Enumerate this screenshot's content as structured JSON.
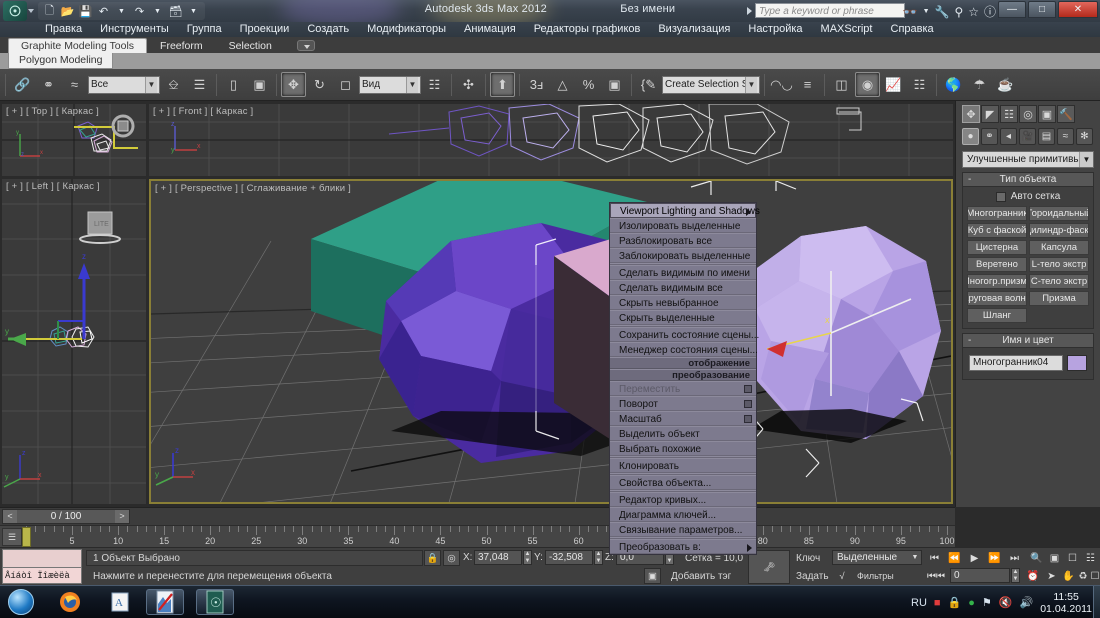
{
  "titlebar": {
    "app_title": "Autodesk 3ds Max  2012",
    "doc_title": "Без имени",
    "search_placeholder": "Type a keyword or phrase",
    "quick_access": [
      "new-icon",
      "open-icon",
      "save-icon",
      "undo-icon",
      "redo-icon",
      "set-icon"
    ],
    "window_buttons": {
      "minimize": "—",
      "maximize": "□",
      "close": "✕"
    },
    "help_icons": [
      "binoculars-icon",
      "wrench-icon",
      "subscription-icon",
      "favorites-icon",
      "help-icon"
    ]
  },
  "menu": {
    "items": [
      "Правка",
      "Инструменты",
      "Группа",
      "Проекции",
      "Создать",
      "Модификаторы",
      "Анимация",
      "Редакторы графиков",
      "Визуализация",
      "Настройка",
      "MAXScript",
      "Справка"
    ]
  },
  "ribbon": {
    "tabs": [
      "Graphite Modeling Tools",
      "Freeform",
      "Selection"
    ],
    "active_tab": "Graphite Modeling Tools",
    "sub_tab": "Polygon Modeling"
  },
  "toolbar": {
    "selection_filter": "Все",
    "reference_coord": "Вид",
    "named_selection_sets": "Create Selection Se",
    "icons_left": [
      "link-icon",
      "unlink-icon",
      "bind-space-warp-icon"
    ],
    "icons_mid": [
      "select-object-icon",
      "select-by-name-icon",
      "rect-selection-icon",
      "window-crossing-icon",
      "select-move-icon",
      "select-rotate-icon",
      "select-scale-icon"
    ],
    "icons_right": [
      "use-pivot-icon",
      "use-selection-center-icon",
      "snap-toggle-icon",
      "angle-snap-icon",
      "percent-snap-icon",
      "spinner-snap-icon",
      "edit-named-sets-icon",
      "mirror-icon",
      "align-icon",
      "layer-manager-icon",
      "curve-editor-icon",
      "schematic-view-icon",
      "material-editor-icon",
      "render-setup-icon",
      "render-frame-icon",
      "render-production-icon"
    ]
  },
  "viewports": [
    {
      "name": "viewport-top",
      "label": "[ + ] [ Top ] [ Каркас ]"
    },
    {
      "name": "viewport-front",
      "label": "[ + ] [ Front ] [ Каркас ]"
    },
    {
      "name": "viewport-left",
      "label": "[ + ] [ Left ] [ Каркас ]"
    },
    {
      "name": "viewport-persp",
      "label": "[ + ] [ Perspective ] [ Сглаживание + блики ]"
    }
  ],
  "context_menu": {
    "items": [
      {
        "label": "Viewport Lighting and Shadows",
        "submenu": true,
        "highlight": true,
        "dim": false
      },
      {
        "label": "Изолировать выделенные",
        "submenu": false,
        "highlight": false,
        "dim": false
      },
      {
        "label": "Разблокировать все",
        "submenu": false,
        "highlight": false,
        "dim": false
      },
      {
        "label": "Заблокировать выделенные",
        "submenu": false,
        "highlight": false,
        "dim": false
      },
      {
        "label": "Сделать видимым по имени",
        "submenu": false,
        "highlight": false,
        "dim": false
      },
      {
        "label": "Сделать видимым все",
        "submenu": false,
        "highlight": false,
        "dim": false
      },
      {
        "label": "Скрыть невыбранное",
        "submenu": false,
        "highlight": false,
        "dim": false
      },
      {
        "label": "Скрыть выделенные",
        "submenu": false,
        "highlight": false,
        "dim": false
      },
      {
        "label": "Сохранить состояние сцены...",
        "submenu": false,
        "highlight": false,
        "dim": false
      },
      {
        "label": "Менеджер состояния сцены...",
        "submenu": false,
        "highlight": false,
        "dim": false
      }
    ],
    "header_display": "отображение",
    "header_transform": "преобразование",
    "transform_items": [
      {
        "label": "Переместить",
        "check": true,
        "dim": true,
        "submenu": false
      },
      {
        "label": "Поворот",
        "check": true,
        "dim": false,
        "submenu": false
      },
      {
        "label": "Масштаб",
        "check": true,
        "dim": false,
        "submenu": false
      },
      {
        "label": "Выделить объект",
        "check": false,
        "dim": false,
        "submenu": false
      },
      {
        "label": "Выбрать похожие",
        "check": false,
        "dim": false,
        "submenu": false
      },
      {
        "label": "Клонировать",
        "check": false,
        "dim": false,
        "submenu": false
      },
      {
        "label": "Свойства объекта...",
        "check": false,
        "dim": false,
        "submenu": false
      },
      {
        "label": "Редактор кривых...",
        "check": false,
        "dim": false,
        "submenu": false
      },
      {
        "label": "Диаграмма ключей...",
        "check": false,
        "dim": false,
        "submenu": false
      },
      {
        "label": "Связывание параметров...",
        "check": false,
        "dim": false,
        "submenu": false
      },
      {
        "label": "Преобразовать в:",
        "check": false,
        "dim": false,
        "submenu": true
      }
    ]
  },
  "command_panel": {
    "tabs": [
      "create-icon",
      "modify-icon",
      "hierarchy-icon",
      "motion-icon",
      "display-icon",
      "utilities-icon"
    ],
    "active_tab_index": 0,
    "categories": [
      "geometry-icon",
      "shapes-icon",
      "lights-icon",
      "cameras-icon",
      "helpers-icon",
      "space-warps-icon",
      "systems-icon"
    ],
    "active_category_index": 0,
    "category_dropdown": "Улучшенные примитивы",
    "object_type": {
      "title": "Тип объекта",
      "autogrid_label": "Авто сетка",
      "buttons": [
        "Многогранник",
        "Тороидальный",
        "Куб с фаской",
        "Цилиндр-фаска",
        "Цистерна",
        "Капсула",
        "Веретено",
        "L-тело экстр",
        "Многогр.призма",
        "C-тело экстр",
        "Круговая волна",
        "Призма",
        "Шланг"
      ]
    },
    "name_and_color": {
      "title": "Имя и цвет",
      "object_name": "Многогранник04",
      "color": "#b7a3e0"
    }
  },
  "timeline": {
    "current_frame_display": "0 / 100",
    "prev_arrow": "<",
    "next_arrow": ">",
    "range_start": 0,
    "range_end": 100,
    "tick_step": 5,
    "labels": [
      0,
      5,
      10,
      15,
      20,
      25,
      30,
      35,
      40,
      45,
      50,
      55,
      60,
      65,
      70,
      75,
      80,
      85,
      90,
      95,
      100
    ],
    "slider_frame": 0
  },
  "statusbar": {
    "maxscript_mini_listener": "Åíáòî Ïîæèëà",
    "selection_status": "1 Объект Выбрано",
    "prompt": "Нажмите и перенестите для перемещения объекта",
    "add_time_tag": "Добавить тэг врем",
    "lock_icon": "lock-icon",
    "coord_mode_icon": "absolute-relative-icon",
    "coords": [
      {
        "axis": "X:",
        "value": "37,048"
      },
      {
        "axis": "Y:",
        "value": "-32,508"
      },
      {
        "axis": "Z:",
        "value": "0,0"
      }
    ],
    "grid_info": "Сетка = 10,0",
    "key_label": "Ключ",
    "set_label": "Задать",
    "auto_key_mode": "Выделенные",
    "key_filters": "Фильтры ключей",
    "frame_field": "0",
    "transport_icons": [
      "go-to-start-icon",
      "prev-frame-icon",
      "play-icon",
      "next-frame-icon",
      "go-to-end-icon"
    ],
    "nav_icons": [
      "zoom-icon",
      "zoom-all-icon",
      "zoom-extents-icon",
      "zoom-region-icon",
      "field-of-view-icon",
      "pan-icon",
      "orbit-icon",
      "maximize-viewport-icon"
    ]
  },
  "taskbar": {
    "start_icon": "windows-start-orb",
    "items": [
      "firefox-icon",
      "wordpad-icon",
      "image-editor-icon",
      "3dsmax-icon"
    ],
    "tray": {
      "language": "RU",
      "icons": [
        "antivirus-icon",
        "security-icon",
        "update-icon",
        "network-icon",
        "volume-muted-icon",
        "speaker-icon"
      ],
      "time": "11:55",
      "date": "01.04.2011"
    }
  }
}
